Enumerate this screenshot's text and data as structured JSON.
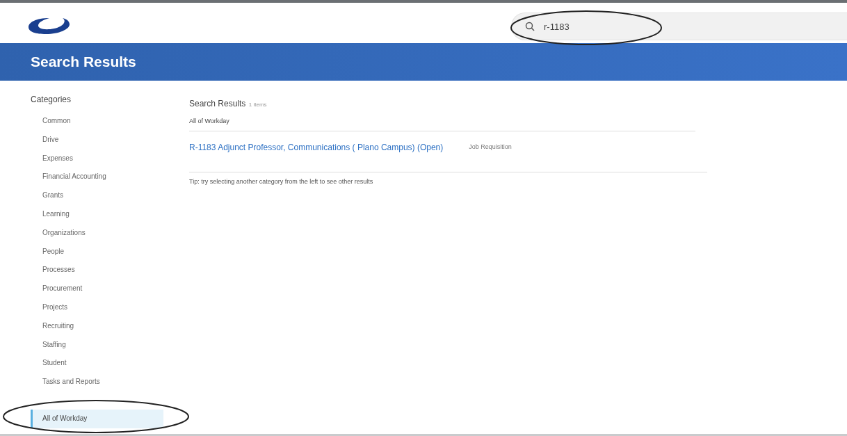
{
  "search": {
    "value": "r-1183"
  },
  "page_title": "Search Results",
  "sidebar": {
    "heading": "Categories",
    "items": [
      {
        "label": "Common",
        "selected": false
      },
      {
        "label": "Drive",
        "selected": false
      },
      {
        "label": "Expenses",
        "selected": false
      },
      {
        "label": "Financial Accounting",
        "selected": false
      },
      {
        "label": "Grants",
        "selected": false
      },
      {
        "label": "Learning",
        "selected": false
      },
      {
        "label": "Organizations",
        "selected": false
      },
      {
        "label": "People",
        "selected": false
      },
      {
        "label": "Processes",
        "selected": false
      },
      {
        "label": "Procurement",
        "selected": false
      },
      {
        "label": "Projects",
        "selected": false
      },
      {
        "label": "Recruiting",
        "selected": false
      },
      {
        "label": "Staffing",
        "selected": false
      },
      {
        "label": "Student",
        "selected": false
      },
      {
        "label": "Tasks and Reports",
        "selected": false
      },
      {
        "label": "All of Workday",
        "selected": true
      }
    ]
  },
  "results": {
    "heading": "Search Results",
    "count": "1 items",
    "category": "All of Workday",
    "items": [
      {
        "title": "R-1183 Adjunct Professor, Communications ( Plano Campus) (Open)",
        "type": "Job Requisition"
      }
    ],
    "tip": "Tip: try selecting another category from the left to see other results"
  }
}
